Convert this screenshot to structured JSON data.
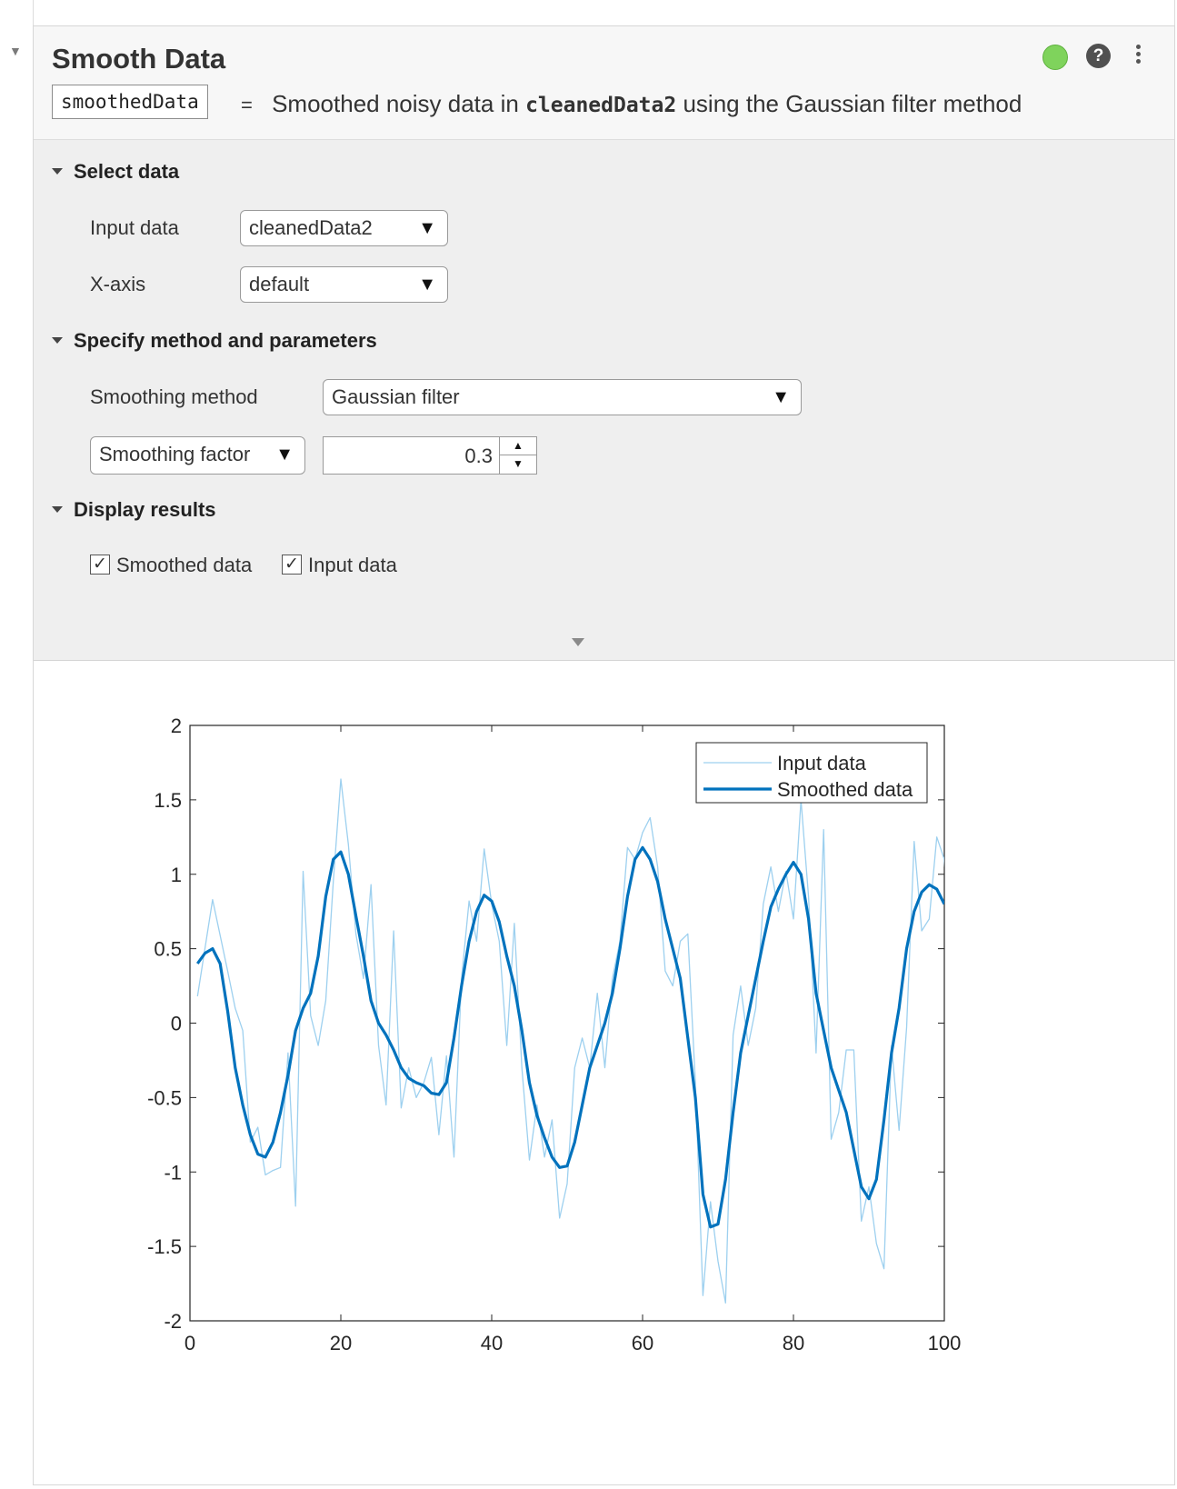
{
  "task": {
    "title": "Smooth Data",
    "output_variable": "smoothedData",
    "summary_prefix": "Smoothed noisy data in",
    "summary_input": "cleanedData2",
    "summary_suffix": "using the Gaussian filter method",
    "status_color": "#7fd35c"
  },
  "sections": {
    "select_data": "Select data",
    "method": "Specify method and parameters",
    "display": "Display results"
  },
  "fields": {
    "input_data_label": "Input data",
    "input_data_value": "cleanedData2",
    "xaxis_label": "X-axis",
    "xaxis_value": "default",
    "method_label": "Smoothing method",
    "method_value": "Gaussian filter",
    "param_type": "Smoothing factor",
    "param_value": "0.3"
  },
  "display": {
    "smoothed_label": "Smoothed data",
    "smoothed_checked": true,
    "input_label": "Input data",
    "input_checked": true
  },
  "icons": {
    "status": "status-dot-icon",
    "help": "help-icon",
    "menu": "more-options-icon",
    "arrow": "▼",
    "check": "✓",
    "spin_up": "▲",
    "spin_down": "▼"
  },
  "chart_data": {
    "type": "line",
    "xlim": [
      0,
      100
    ],
    "ylim": [
      -2,
      2
    ],
    "xticks": [
      0,
      20,
      40,
      60,
      80,
      100
    ],
    "xtick_labels": [
      "0",
      "20",
      "40",
      "60",
      "80",
      "100"
    ],
    "yticks": [
      2,
      1.5,
      1,
      0.5,
      0,
      -0.5,
      -1,
      -1.5,
      -2
    ],
    "ytick_labels": [
      "2",
      "1.5",
      "1",
      "0.5",
      "0",
      "-0.5",
      "-1",
      "-1.5",
      "-2"
    ],
    "legend_position": "top-right",
    "series": [
      {
        "name": "Input data",
        "color": "#9dd0ef",
        "points": [
          [
            1,
            0.18
          ],
          [
            3,
            0.83
          ],
          [
            5,
            0.35
          ],
          [
            6,
            0.1
          ],
          [
            7,
            -0.05
          ],
          [
            8,
            -0.8
          ],
          [
            9,
            -0.7
          ],
          [
            10,
            -1.02
          ],
          [
            11,
            -0.99
          ],
          [
            12,
            -0.97
          ],
          [
            13,
            -0.2
          ],
          [
            14,
            -1.23
          ],
          [
            15,
            1.02
          ],
          [
            16,
            0.05
          ],
          [
            17,
            -0.15
          ],
          [
            18,
            0.15
          ],
          [
            19,
            0.95
          ],
          [
            20,
            1.64
          ],
          [
            21,
            1.2
          ],
          [
            22,
            0.6
          ],
          [
            23,
            0.3
          ],
          [
            24,
            0.93
          ],
          [
            25,
            -0.15
          ],
          [
            26,
            -0.55
          ],
          [
            27,
            0.62
          ],
          [
            28,
            -0.57
          ],
          [
            29,
            -0.3
          ],
          [
            30,
            -0.5
          ],
          [
            31,
            -0.4
          ],
          [
            32,
            -0.23
          ],
          [
            33,
            -0.75
          ],
          [
            34,
            -0.22
          ],
          [
            35,
            -0.9
          ],
          [
            36,
            0.3
          ],
          [
            37,
            0.82
          ],
          [
            38,
            0.55
          ],
          [
            39,
            1.17
          ],
          [
            40,
            0.8
          ],
          [
            41,
            0.55
          ],
          [
            42,
            -0.15
          ],
          [
            43,
            0.67
          ],
          [
            44,
            -0.3
          ],
          [
            45,
            -0.92
          ],
          [
            46,
            -0.55
          ],
          [
            47,
            -0.9
          ],
          [
            48,
            -0.65
          ],
          [
            49,
            -1.31
          ],
          [
            50,
            -1.08
          ],
          [
            51,
            -0.3
          ],
          [
            52,
            -0.1
          ],
          [
            53,
            -0.3
          ],
          [
            54,
            0.2
          ],
          [
            55,
            -0.3
          ],
          [
            56,
            0.3
          ],
          [
            57,
            0.55
          ],
          [
            58,
            1.18
          ],
          [
            59,
            1.1
          ],
          [
            60,
            1.28
          ],
          [
            61,
            1.38
          ],
          [
            62,
            1.05
          ],
          [
            63,
            0.35
          ],
          [
            64,
            0.25
          ],
          [
            65,
            0.55
          ],
          [
            66,
            0.6
          ],
          [
            67,
            -0.4
          ],
          [
            68,
            -1.83
          ],
          [
            69,
            -1.2
          ],
          [
            70,
            -1.6
          ],
          [
            71,
            -1.88
          ],
          [
            72,
            -0.08
          ],
          [
            73,
            0.25
          ],
          [
            74,
            -0.15
          ],
          [
            75,
            0.1
          ],
          [
            76,
            0.8
          ],
          [
            77,
            1.05
          ],
          [
            78,
            0.75
          ],
          [
            79,
            1.02
          ],
          [
            80,
            0.7
          ],
          [
            81,
            1.5
          ],
          [
            82,
            0.85
          ],
          [
            83,
            -0.2
          ],
          [
            84,
            1.3
          ],
          [
            85,
            -0.78
          ],
          [
            86,
            -0.6
          ],
          [
            87,
            -0.18
          ],
          [
            88,
            -0.18
          ],
          [
            89,
            -1.33
          ],
          [
            90,
            -1.1
          ],
          [
            91,
            -1.48
          ],
          [
            92,
            -1.65
          ],
          [
            93,
            -0.15
          ],
          [
            94,
            -0.72
          ],
          [
            95,
            -0.03
          ],
          [
            96,
            1.22
          ],
          [
            97,
            0.62
          ],
          [
            98,
            0.7
          ],
          [
            99,
            1.25
          ],
          [
            100,
            1.1
          ],
          [
            101,
            0.4
          ]
        ]
      },
      {
        "name": "Smoothed data",
        "color": "#0072bd",
        "points": [
          [
            1,
            0.4
          ],
          [
            2,
            0.47
          ],
          [
            3,
            0.5
          ],
          [
            4,
            0.4
          ],
          [
            5,
            0.08
          ],
          [
            6,
            -0.3
          ],
          [
            7,
            -0.55
          ],
          [
            8,
            -0.75
          ],
          [
            9,
            -0.88
          ],
          [
            10,
            -0.9
          ],
          [
            11,
            -0.8
          ],
          [
            12,
            -0.6
          ],
          [
            13,
            -0.35
          ],
          [
            14,
            -0.05
          ],
          [
            15,
            0.1
          ],
          [
            16,
            0.2
          ],
          [
            17,
            0.45
          ],
          [
            18,
            0.85
          ],
          [
            19,
            1.1
          ],
          [
            20,
            1.15
          ],
          [
            21,
            1.0
          ],
          [
            22,
            0.72
          ],
          [
            23,
            0.45
          ],
          [
            24,
            0.15
          ],
          [
            25,
            0.0
          ],
          [
            26,
            -0.08
          ],
          [
            27,
            -0.18
          ],
          [
            28,
            -0.3
          ],
          [
            29,
            -0.37
          ],
          [
            30,
            -0.4
          ],
          [
            31,
            -0.42
          ],
          [
            32,
            -0.47
          ],
          [
            33,
            -0.48
          ],
          [
            34,
            -0.4
          ],
          [
            35,
            -0.1
          ],
          [
            36,
            0.25
          ],
          [
            37,
            0.55
          ],
          [
            38,
            0.75
          ],
          [
            39,
            0.86
          ],
          [
            40,
            0.82
          ],
          [
            41,
            0.68
          ],
          [
            42,
            0.45
          ],
          [
            43,
            0.25
          ],
          [
            44,
            -0.05
          ],
          [
            45,
            -0.4
          ],
          [
            46,
            -0.62
          ],
          [
            47,
            -0.77
          ],
          [
            48,
            -0.9
          ],
          [
            49,
            -0.97
          ],
          [
            50,
            -0.96
          ],
          [
            51,
            -0.8
          ],
          [
            52,
            -0.55
          ],
          [
            53,
            -0.3
          ],
          [
            54,
            -0.15
          ],
          [
            55,
            0.0
          ],
          [
            56,
            0.2
          ],
          [
            57,
            0.5
          ],
          [
            58,
            0.85
          ],
          [
            59,
            1.1
          ],
          [
            60,
            1.18
          ],
          [
            61,
            1.1
          ],
          [
            62,
            0.95
          ],
          [
            63,
            0.7
          ],
          [
            64,
            0.5
          ],
          [
            65,
            0.3
          ],
          [
            66,
            -0.1
          ],
          [
            67,
            -0.5
          ],
          [
            68,
            -1.15
          ],
          [
            69,
            -1.37
          ],
          [
            70,
            -1.35
          ],
          [
            71,
            -1.05
          ],
          [
            72,
            -0.6
          ],
          [
            73,
            -0.2
          ],
          [
            74,
            0.05
          ],
          [
            75,
            0.3
          ],
          [
            76,
            0.55
          ],
          [
            77,
            0.78
          ],
          [
            78,
            0.9
          ],
          [
            79,
            1.0
          ],
          [
            80,
            1.08
          ],
          [
            81,
            1.0
          ],
          [
            82,
            0.7
          ],
          [
            83,
            0.2
          ],
          [
            84,
            -0.05
          ],
          [
            85,
            -0.3
          ],
          [
            86,
            -0.45
          ],
          [
            87,
            -0.6
          ],
          [
            88,
            -0.85
          ],
          [
            89,
            -1.1
          ],
          [
            90,
            -1.18
          ],
          [
            91,
            -1.05
          ],
          [
            92,
            -0.65
          ],
          [
            93,
            -0.2
          ],
          [
            94,
            0.1
          ],
          [
            95,
            0.5
          ],
          [
            96,
            0.75
          ],
          [
            97,
            0.88
          ],
          [
            98,
            0.93
          ],
          [
            99,
            0.9
          ],
          [
            100,
            0.8
          ]
        ]
      }
    ]
  }
}
